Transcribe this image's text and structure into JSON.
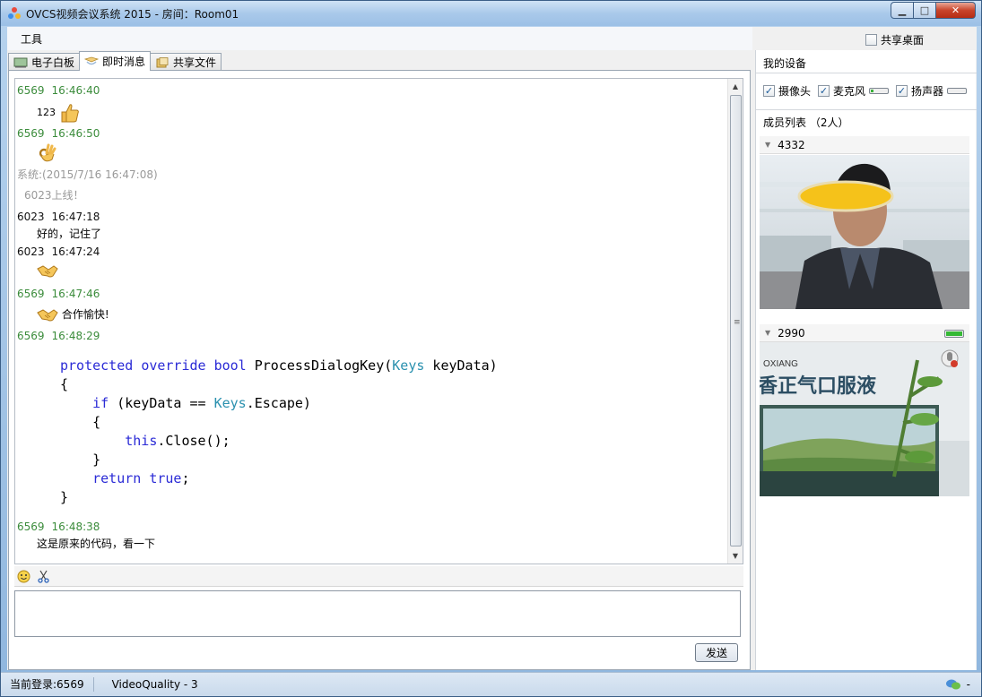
{
  "window": {
    "title": "OVCS视频会议系统 2015 - 房间：Room01"
  },
  "menu": {
    "tools": "工具",
    "share_desktop": "共享桌面"
  },
  "tabs": [
    {
      "label": "电子白板",
      "icon": "whiteboard-icon"
    },
    {
      "label": "即时消息",
      "icon": "message-icon"
    },
    {
      "label": "共享文件",
      "icon": "folder-icon"
    }
  ],
  "messages": {
    "m1": {
      "user": "6569",
      "time": "16:46:40",
      "text": "123"
    },
    "m2": {
      "user": "6569",
      "time": "16:46:50"
    },
    "m3": {
      "sys_meta": "系统:(2015/7/16 16:47:08)",
      "text": "6023上线！"
    },
    "m4": {
      "user": "6023",
      "time": "16:47:18",
      "text": "好的，记住了"
    },
    "m5": {
      "user": "6023",
      "time": "16:47:24"
    },
    "m6": {
      "user": "6569",
      "time": "16:47:46",
      "text": "合作愉快!"
    },
    "m7": {
      "user": "6569",
      "time": "16:48:29"
    },
    "m8": {
      "user": "6569",
      "time": "16:48:38",
      "text": "这是原来的代码，看一下"
    }
  },
  "code": {
    "l1_kw1": "protected",
    "l1_kw2": "override",
    "l1_kw3": "bool",
    "l1_name": "ProcessDialogKey(",
    "l1_type": "Keys",
    "l1_rest": " keyData)",
    "l2": "{",
    "l3_kw": "if",
    "l3_a": " (keyData == ",
    "l3_type": "Keys",
    "l3_b": ".Escape)",
    "l4": "{",
    "l5_kw": "this",
    "l5_rest": ".Close();",
    "l6": "}",
    "l7_kw": "return",
    "l7_kw2": "true",
    "l7_rest": ";",
    "l8": "}"
  },
  "input": {
    "send_label": "发送"
  },
  "right_panel": {
    "devices_title": "我的设备",
    "camera": "摄像头",
    "mic": "麦克风",
    "speaker": "扬声器",
    "members_title": "成员列表 （2人）",
    "member1": "4332",
    "member2": "2990",
    "video2_text_top": "OXIANG",
    "video2_text_main": "香正气口服液"
  },
  "status": {
    "login": "当前登录:6569",
    "quality": "VideoQuality - 3",
    "dash": "-"
  },
  "colors": {
    "own_message": "#3b8c3b",
    "keyword": "#2b2bd6",
    "type": "#2b91af"
  }
}
